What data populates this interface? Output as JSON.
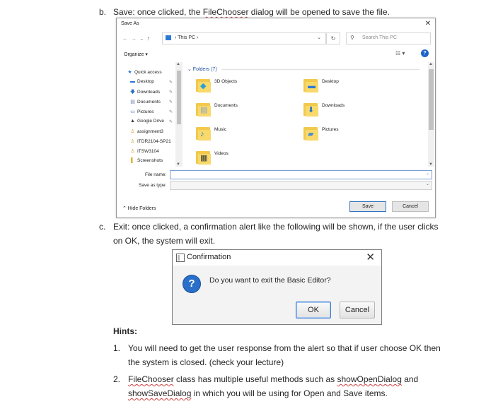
{
  "doc": {
    "item_b": {
      "marker": "b.",
      "text_before": "Save: once clicked, the ",
      "squiggle": "FileChooser",
      "text_after": " dialog will be opened to save the file."
    },
    "item_c": {
      "marker": "c.",
      "line1": "Exit: once clicked, a confirmation alert like the following will be shown, if the user clicks",
      "line2": "on OK, the system will exit."
    },
    "hints_title": "Hints:",
    "hint1": {
      "marker": "1.",
      "line1": "You will need to get the user response from the alert so that if user choose OK then",
      "line2": "the system is closed. (check your lecture)"
    },
    "hint2": {
      "marker": "2.",
      "squiggle1": "FileChooser",
      "line1_rest": " class has multiple useful methods such as ",
      "squiggle2": "showOpenDialog",
      "line1_end": " and",
      "squiggle3": "showSaveDialog",
      "line2_rest": " in which you will be using for Open and Save items."
    }
  },
  "save_dialog": {
    "title": "Save As",
    "close": "✕",
    "nav_back": "←",
    "nav_forward": "→",
    "nav_recent": "⌄",
    "nav_up": "↑",
    "address_path": "› This PC ›",
    "address_dropdown": "⌄",
    "refresh": "↻",
    "search_placeholder": "Search This PC",
    "search_icon": "⚲",
    "organize": "Organize ▾",
    "view_button": "☷ ▾",
    "help": "?",
    "nav_items": [
      {
        "icon": "★",
        "label": "Quick access",
        "pinned": false
      },
      {
        "icon": "▬",
        "label": "Desktop",
        "pinned": true
      },
      {
        "icon": "🡇",
        "label": "Downloads",
        "pinned": true
      },
      {
        "icon": "▤",
        "label": "Documents",
        "pinned": true
      },
      {
        "icon": "▭",
        "label": "Pictures",
        "pinned": true
      },
      {
        "icon": "▲",
        "label": "Google Drive",
        "pinned": true
      },
      {
        "icon": "♙",
        "label": "assignment3",
        "pinned": false
      },
      {
        "icon": "♙",
        "label": "ITDR2104-SP21",
        "pinned": false
      },
      {
        "icon": "♙",
        "label": "ITSW3104",
        "pinned": false
      },
      {
        "icon": "▌",
        "label": "Screenshots",
        "pinned": false
      }
    ],
    "pin_glyph": "✎",
    "folders_header": "⌄ Folders (7)",
    "folders": [
      {
        "label": "3D Objects",
        "glyph": "◆",
        "color": "#2a9fd6"
      },
      {
        "label": "Desktop",
        "glyph": "▬",
        "color": "#2b78d6"
      },
      {
        "label": "Documents",
        "glyph": "▤",
        "color": "#8aa2c8"
      },
      {
        "label": "Downloads",
        "glyph": "⬇",
        "color": "#2b6fc6"
      },
      {
        "label": "Music",
        "glyph": "♪",
        "color": "#2b6fc6"
      },
      {
        "label": "Pictures",
        "glyph": "▰",
        "color": "#4a8ad0"
      },
      {
        "label": "Videos",
        "glyph": "▦",
        "color": "#3a3a3a"
      }
    ],
    "file_name_label": "File name:",
    "save_as_type_label": "Save as type:",
    "dropdown_arrow": "⌄",
    "hide_folders": "⌃ Hide Folders",
    "save_button": "Save",
    "cancel_button": "Cancel"
  },
  "confirm_dialog": {
    "title": "Confirmation",
    "close": "✕",
    "question_icon": "?",
    "message": "Do you want to exit the Basic Editor?",
    "ok": "OK",
    "cancel": "Cancel",
    "accent": "#2a6fc9"
  }
}
